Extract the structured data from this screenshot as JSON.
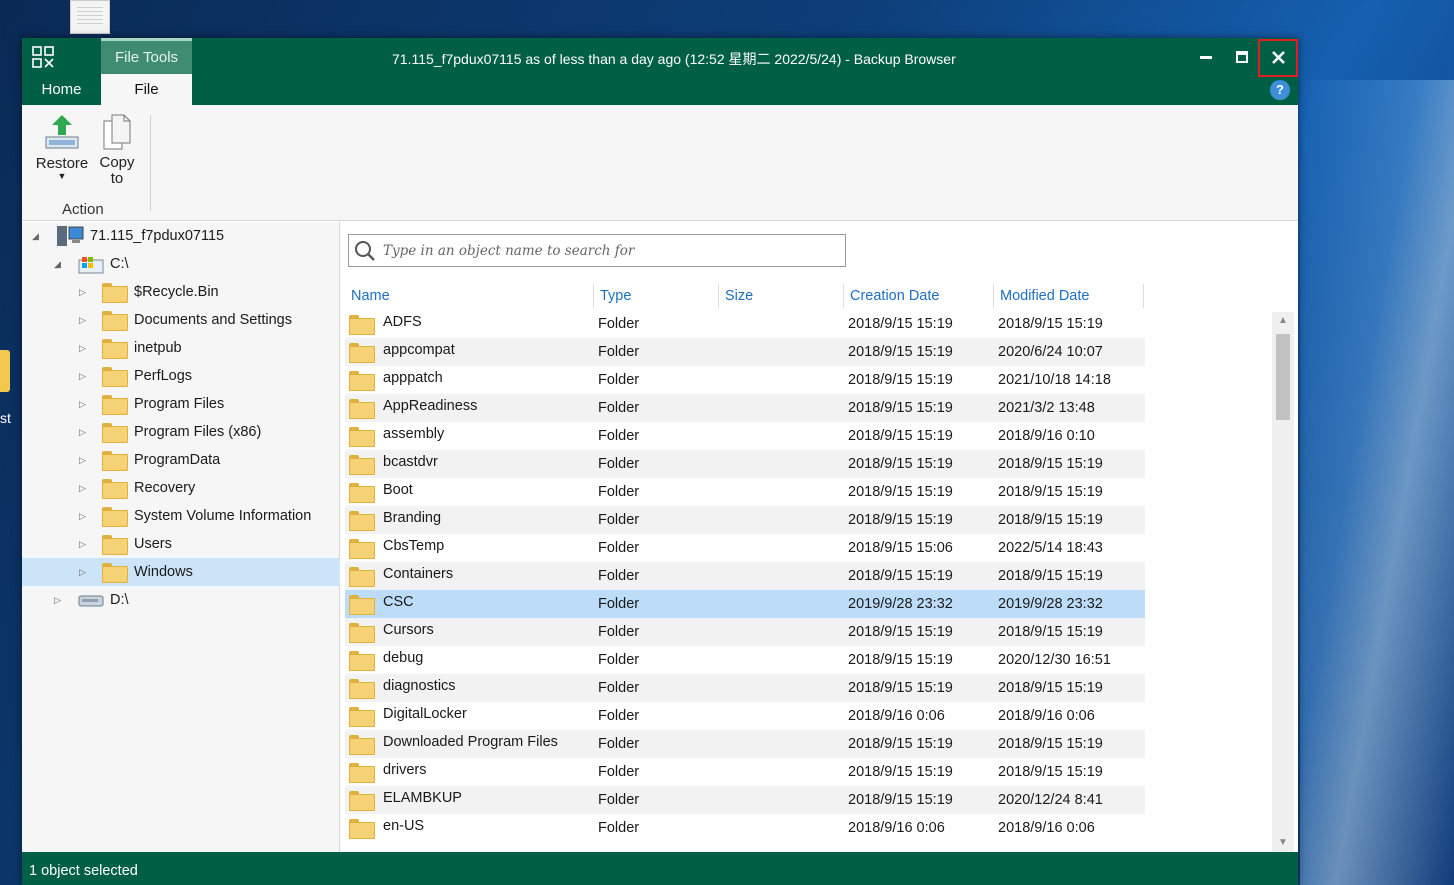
{
  "desktop": {
    "icon_label": "st"
  },
  "window": {
    "title": "71.115_f7pdux07115 as of less than a day ago (12:52 星期二 2022/5/24) - Backup Browser",
    "tool_tab_header": "File Tools",
    "tabs": [
      {
        "label": "Home"
      },
      {
        "label": "File"
      }
    ],
    "help_label": "?"
  },
  "ribbon": {
    "restore_label": "Restore",
    "copy_label": "Copy\nto",
    "copy_line1": "Copy",
    "copy_line2": "to",
    "group_label": "Action"
  },
  "tree": {
    "root": "71.115_f7pdux07115",
    "drive_c": "C:\\",
    "drive_d": "D:\\",
    "folders": [
      "$Recycle.Bin",
      "Documents and Settings",
      "inetpub",
      "PerfLogs",
      "Program Files",
      "Program Files (x86)",
      "ProgramData",
      "Recovery",
      "System Volume Information",
      "Users",
      "Windows"
    ],
    "selected": "Windows"
  },
  "search": {
    "placeholder": "Type in an object name to search for"
  },
  "columns": [
    "Name",
    "Type",
    "Size",
    "Creation Date",
    "Modified Date"
  ],
  "files": [
    {
      "name": "ADFS",
      "type": "Folder",
      "size": "",
      "created": "2018/9/15 15:19",
      "modified": "2018/9/15 15:19"
    },
    {
      "name": "appcompat",
      "type": "Folder",
      "size": "",
      "created": "2018/9/15 15:19",
      "modified": "2020/6/24 10:07"
    },
    {
      "name": "apppatch",
      "type": "Folder",
      "size": "",
      "created": "2018/9/15 15:19",
      "modified": "2021/10/18 14:18"
    },
    {
      "name": "AppReadiness",
      "type": "Folder",
      "size": "",
      "created": "2018/9/15 15:19",
      "modified": "2021/3/2 13:48"
    },
    {
      "name": "assembly",
      "type": "Folder",
      "size": "",
      "created": "2018/9/15 15:19",
      "modified": "2018/9/16 0:10"
    },
    {
      "name": "bcastdvr",
      "type": "Folder",
      "size": "",
      "created": "2018/9/15 15:19",
      "modified": "2018/9/15 15:19"
    },
    {
      "name": "Boot",
      "type": "Folder",
      "size": "",
      "created": "2018/9/15 15:19",
      "modified": "2018/9/15 15:19"
    },
    {
      "name": "Branding",
      "type": "Folder",
      "size": "",
      "created": "2018/9/15 15:19",
      "modified": "2018/9/15 15:19"
    },
    {
      "name": "CbsTemp",
      "type": "Folder",
      "size": "",
      "created": "2018/9/15 15:06",
      "modified": "2022/5/14 18:43"
    },
    {
      "name": "Containers",
      "type": "Folder",
      "size": "",
      "created": "2018/9/15 15:19",
      "modified": "2018/9/15 15:19"
    },
    {
      "name": "CSC",
      "type": "Folder",
      "size": "",
      "created": "2019/9/28 23:32",
      "modified": "2019/9/28 23:32"
    },
    {
      "name": "Cursors",
      "type": "Folder",
      "size": "",
      "created": "2018/9/15 15:19",
      "modified": "2018/9/15 15:19"
    },
    {
      "name": "debug",
      "type": "Folder",
      "size": "",
      "created": "2018/9/15 15:19",
      "modified": "2020/12/30 16:51"
    },
    {
      "name": "diagnostics",
      "type": "Folder",
      "size": "",
      "created": "2018/9/15 15:19",
      "modified": "2018/9/15 15:19"
    },
    {
      "name": "DigitalLocker",
      "type": "Folder",
      "size": "",
      "created": "2018/9/16 0:06",
      "modified": "2018/9/16 0:06"
    },
    {
      "name": "Downloaded Program Files",
      "type": "Folder",
      "size": "",
      "created": "2018/9/15 15:19",
      "modified": "2018/9/15 15:19"
    },
    {
      "name": "drivers",
      "type": "Folder",
      "size": "",
      "created": "2018/9/15 15:19",
      "modified": "2018/9/15 15:19"
    },
    {
      "name": "ELAMBKUP",
      "type": "Folder",
      "size": "",
      "created": "2018/9/15 15:19",
      "modified": "2020/12/24 8:41"
    },
    {
      "name": "en-US",
      "type": "Folder",
      "size": "",
      "created": "2018/9/16 0:06",
      "modified": "2018/9/16 0:06"
    }
  ],
  "selected_file": "CSC",
  "status": {
    "text": "1 object selected"
  },
  "colors": {
    "brand": "#005f45",
    "selection": "#bcdcf8",
    "tree_selection": "#cce4f7",
    "header_text": "#1f6fc1",
    "close_highlight": "#e02020"
  }
}
